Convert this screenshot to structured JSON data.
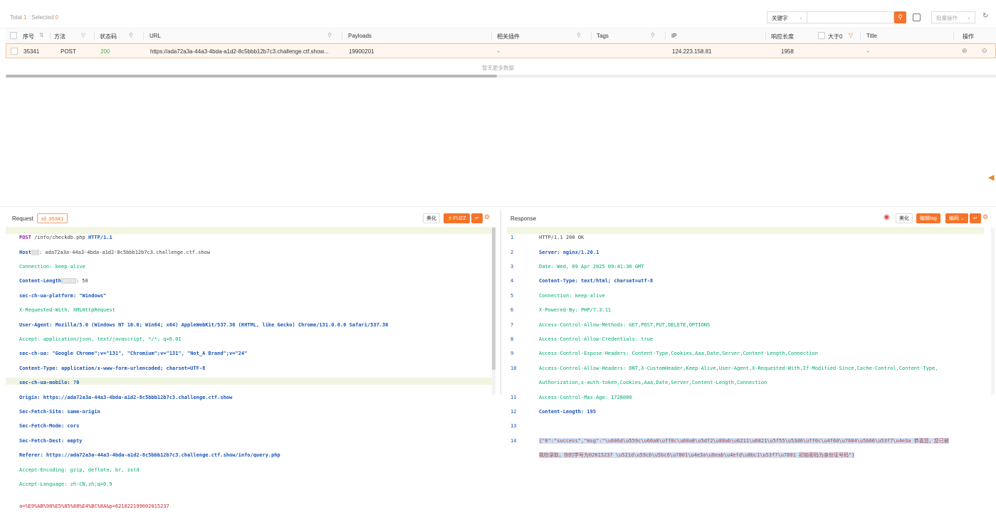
{
  "toolbar": {
    "total_label": "Total",
    "total": "1",
    "selected_label": "Selected",
    "selected": "0",
    "keyword_select": "关键字",
    "batch_label": "批量操作"
  },
  "table": {
    "columns": [
      "序号",
      "方法",
      "状态码",
      "URL",
      "Payloads",
      "相关插件",
      "Tags",
      "IP",
      "响应长度",
      "大于0",
      "Title",
      "操作"
    ],
    "row": {
      "id": "35341",
      "method": "POST",
      "status": "200",
      "url": "https://ada72a3a-44a3-4bda-a1d2-8c5bbb12b7c3.challenge.ctf.show...",
      "payloads": "19900201",
      "plugins": "-",
      "tags": "",
      "ip": "124.223.158.81",
      "length": "1958",
      "title": "-"
    },
    "no_more": "暂无更多数据"
  },
  "request": {
    "title": "Request",
    "id_tag": "Id: 35341",
    "beautify": "美化",
    "fuzz": "⚡FUZZ",
    "lines": [
      "POST /info/checkdb.php HTTP/1.1",
      "Host ⓘ: ada72a3a-44a3-4bda-a1d2-8c5bbb12b7c3.challenge.ctf.show",
      "Connection: keep-alive",
      "Content-Length auto: 50",
      "sec-ch-ua-platform: \"Windows\"",
      "X-Requested-With: XMLHttpRequest",
      "User-Agent: Mozilla/5.0 (Windows NT 10.0; Win64; x64) AppleWebKit/537.36 (KHTML, like Gecko) Chrome/131.0.0.0 Safari/537.36",
      "Accept: application/json, text/javascript, */*; q=0.01",
      "sec-ch-ua: \"Google Chrome\";v=\"131\", \"Chromium\";v=\"131\", \"Not_A Brand\";v=\"24\"",
      "Content-Type: application/x-www-form-urlencoded; charset=UTF-8",
      "sec-ch-ua-mobile: ?0",
      "Origin: https://ada72a3a-44a3-4bda-a1d2-8c5bbb12b7c3.challenge.ctf.show",
      "Sec-Fetch-Site: same-origin",
      "Sec-Fetch-Mode: cors",
      "Sec-Fetch-Dest: empty",
      "Referer: https://ada72a3a-44a3-4bda-a1d2-8c5bbb12b7c3.challenge.ctf.show/info/query.php",
      "Accept-Encoding: gzip, deflate, br, zstd",
      "Accept-Language: zh-CN,zh;q=0.9",
      "",
      "a=%E9%AB%98%E5%85%88%E4%BC%8A&p=621022199002015237"
    ]
  },
  "response": {
    "title": "Response",
    "beautify": "美化",
    "edit_tag": "编辑tag",
    "encode": "编码",
    "lines": [
      "HTTP/1.1 200 OK",
      "Server: nginx/1.20.1",
      "Date: Wed, 09 Apr 2025 09:41:30 GMT",
      "Content-Type: text/html; charset=utf-8",
      "Connection: keep-alive",
      "X-Powered-By: PHP/7.3.11",
      "Access-Control-Allow-Methods: GET,POST,PUT,DELETE,OPTIONS",
      "Access-Control-Allow-Credentials: true",
      "Access-Control-Expose-Headers: Content-Type,Cookies,Aaa,Date,Server,Content-Length,Connection",
      "Access-Control-Allow-Headers: DNT,X-CustomHeader,Keep-Alive,User-Agent,X-Requested-With,If-Modified-Since,Cache-Control,Content-Type,",
      "Authorization,x-auth-token,Cookies,Aaa,Date,Server,Content-Length,Connection",
      "Access-Control-Max-Age: 1728000",
      "Content-Length: 195",
      "",
      "{\"0\":\"success\",\"msg\":\"\\u606d\\u559c\\u60a8\\uff0c\\u60a8\\u5df2\\u88ab\\u6211\\u6821\\u5f55\\u53d6\\uff0c\\u4f60\\u7684\\u5b66\\u53f7\\u4e3a 恭喜您，您已被",
      "我校录取，你的学号为02015237 \\u521d\\u59cb\\u5bc6\\u7801\\u4e3a\\u8eab\\u4efd\\u8bc1\\u53f7\\u7801 初始密码为身份证号码\"}"
    ],
    "line_numbers": [
      "1",
      "2",
      "3",
      "4",
      "5",
      "6",
      "7",
      "8",
      "9",
      "10",
      "",
      "11",
      "12",
      "13",
      "14",
      ""
    ]
  }
}
